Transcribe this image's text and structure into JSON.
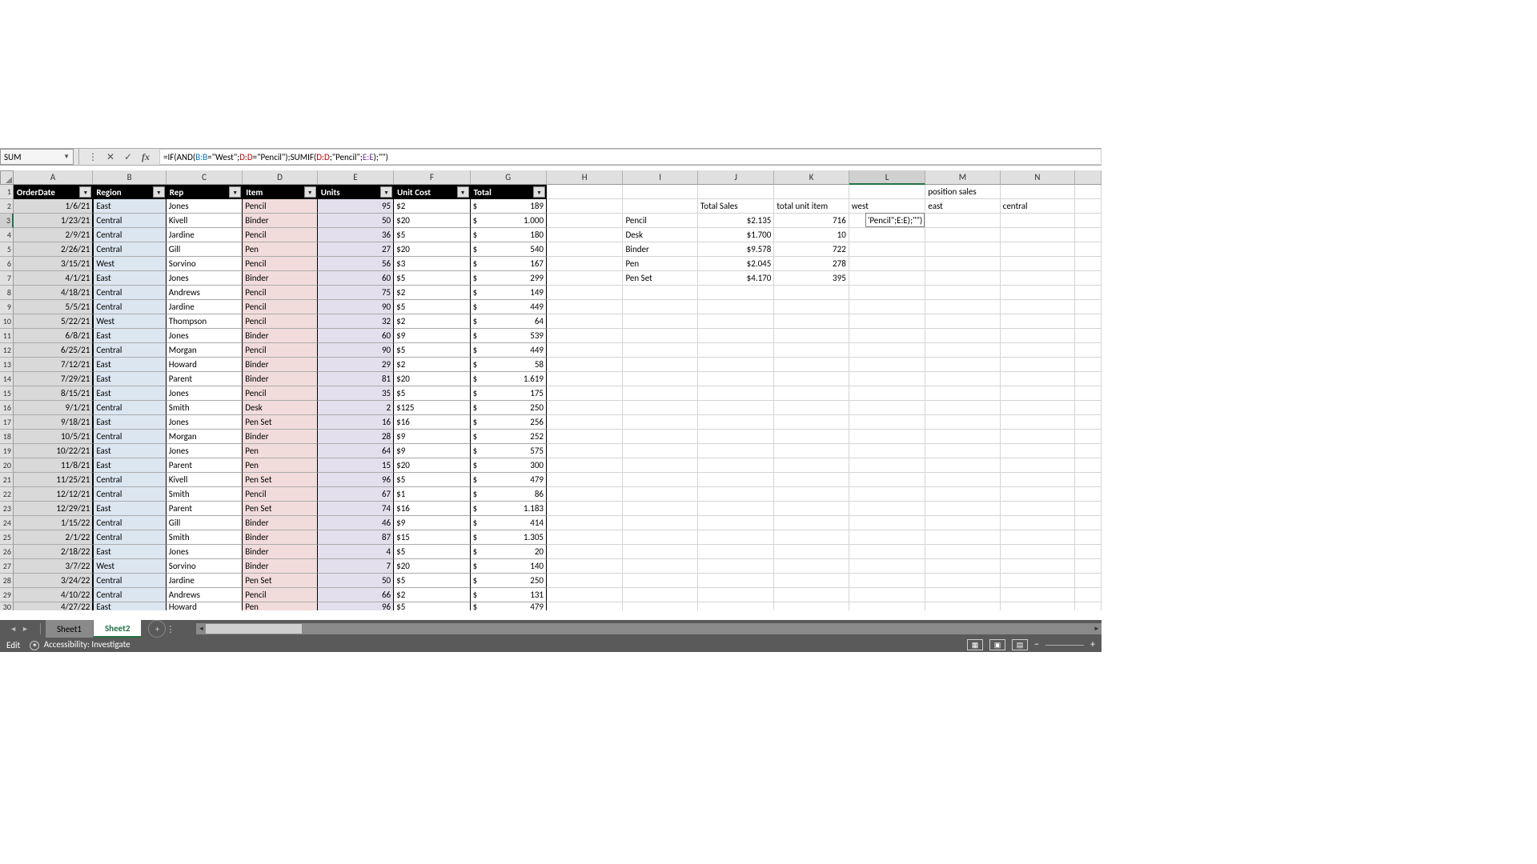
{
  "nameBox": "SUM",
  "formula": {
    "prefix": "=IF(AND(",
    "p1": "B:B",
    "mid1": "=\"West\";",
    "p2": "D:D",
    "mid2": "=\"Pencil\");SUMIF(",
    "p3": "D:D",
    "mid3": ";\"Pencil\";",
    "p4": "E:E",
    "suffix": ");\"\")"
  },
  "columns": [
    "A",
    "B",
    "C",
    "D",
    "E",
    "F",
    "G",
    "H",
    "I",
    "J",
    "K",
    "L",
    "M",
    "N"
  ],
  "activeCol": "L",
  "activeRow": 3,
  "headers": {
    "A": "OrderDate",
    "B": "Region",
    "C": "Rep",
    "D": "Item",
    "E": "Units",
    "F": "Unit Cost",
    "G": "Total"
  },
  "dataRows": [
    {
      "n": 2,
      "A": "1/6/21",
      "B": "East",
      "C": "Jones",
      "D": "Pencil",
      "E": "95",
      "F": "$2",
      "G": "189"
    },
    {
      "n": 3,
      "A": "1/23/21",
      "B": "Central",
      "C": "Kivell",
      "D": "Binder",
      "E": "50",
      "F": "$20",
      "G": "1.000"
    },
    {
      "n": 4,
      "A": "2/9/21",
      "B": "Central",
      "C": "Jardine",
      "D": "Pencil",
      "E": "36",
      "F": "$5",
      "G": "180"
    },
    {
      "n": 5,
      "A": "2/26/21",
      "B": "Central",
      "C": "Gill",
      "D": "Pen",
      "E": "27",
      "F": "$20",
      "G": "540"
    },
    {
      "n": 6,
      "A": "3/15/21",
      "B": "West",
      "C": "Sorvino",
      "D": "Pencil",
      "E": "56",
      "F": "$3",
      "G": "167"
    },
    {
      "n": 7,
      "A": "4/1/21",
      "B": "East",
      "C": "Jones",
      "D": "Binder",
      "E": "60",
      "F": "$5",
      "G": "299"
    },
    {
      "n": 8,
      "A": "4/18/21",
      "B": "Central",
      "C": "Andrews",
      "D": "Pencil",
      "E": "75",
      "F": "$2",
      "G": "149"
    },
    {
      "n": 9,
      "A": "5/5/21",
      "B": "Central",
      "C": "Jardine",
      "D": "Pencil",
      "E": "90",
      "F": "$5",
      "G": "449"
    },
    {
      "n": 10,
      "A": "5/22/21",
      "B": "West",
      "C": "Thompson",
      "D": "Pencil",
      "E": "32",
      "F": "$2",
      "G": "64"
    },
    {
      "n": 11,
      "A": "6/8/21",
      "B": "East",
      "C": "Jones",
      "D": "Binder",
      "E": "60",
      "F": "$9",
      "G": "539"
    },
    {
      "n": 12,
      "A": "6/25/21",
      "B": "Central",
      "C": "Morgan",
      "D": "Pencil",
      "E": "90",
      "F": "$5",
      "G": "449"
    },
    {
      "n": 13,
      "A": "7/12/21",
      "B": "East",
      "C": "Howard",
      "D": "Binder",
      "E": "29",
      "F": "$2",
      "G": "58"
    },
    {
      "n": 14,
      "A": "7/29/21",
      "B": "East",
      "C": "Parent",
      "D": "Binder",
      "E": "81",
      "F": "$20",
      "G": "1.619"
    },
    {
      "n": 15,
      "A": "8/15/21",
      "B": "East",
      "C": "Jones",
      "D": "Pencil",
      "E": "35",
      "F": "$5",
      "G": "175"
    },
    {
      "n": 16,
      "A": "9/1/21",
      "B": "Central",
      "C": "Smith",
      "D": "Desk",
      "E": "2",
      "F": "$125",
      "G": "250"
    },
    {
      "n": 17,
      "A": "9/18/21",
      "B": "East",
      "C": "Jones",
      "D": "Pen Set",
      "E": "16",
      "F": "$16",
      "G": "256"
    },
    {
      "n": 18,
      "A": "10/5/21",
      "B": "Central",
      "C": "Morgan",
      "D": "Binder",
      "E": "28",
      "F": "$9",
      "G": "252"
    },
    {
      "n": 19,
      "A": "10/22/21",
      "B": "East",
      "C": "Jones",
      "D": "Pen",
      "E": "64",
      "F": "$9",
      "G": "575"
    },
    {
      "n": 20,
      "A": "11/8/21",
      "B": "East",
      "C": "Parent",
      "D": "Pen",
      "E": "15",
      "F": "$20",
      "G": "300"
    },
    {
      "n": 21,
      "A": "11/25/21",
      "B": "Central",
      "C": "Kivell",
      "D": "Pen Set",
      "E": "96",
      "F": "$5",
      "G": "479"
    },
    {
      "n": 22,
      "A": "12/12/21",
      "B": "Central",
      "C": "Smith",
      "D": "Pencil",
      "E": "67",
      "F": "$1",
      "G": "86"
    },
    {
      "n": 23,
      "A": "12/29/21",
      "B": "East",
      "C": "Parent",
      "D": "Pen Set",
      "E": "74",
      "F": "$16",
      "G": "1.183"
    },
    {
      "n": 24,
      "A": "1/15/22",
      "B": "Central",
      "C": "Gill",
      "D": "Binder",
      "E": "46",
      "F": "$9",
      "G": "414"
    },
    {
      "n": 25,
      "A": "2/1/22",
      "B": "Central",
      "C": "Smith",
      "D": "Binder",
      "E": "87",
      "F": "$15",
      "G": "1.305"
    },
    {
      "n": 26,
      "A": "2/18/22",
      "B": "East",
      "C": "Jones",
      "D": "Binder",
      "E": "4",
      "F": "$5",
      "G": "20"
    },
    {
      "n": 27,
      "A": "3/7/22",
      "B": "West",
      "C": "Sorvino",
      "D": "Binder",
      "E": "7",
      "F": "$20",
      "G": "140"
    },
    {
      "n": 28,
      "A": "3/24/22",
      "B": "Central",
      "C": "Jardine",
      "D": "Pen Set",
      "E": "50",
      "F": "$5",
      "G": "250"
    },
    {
      "n": 29,
      "A": "4/10/22",
      "B": "Central",
      "C": "Andrews",
      "D": "Pencil",
      "E": "66",
      "F": "$2",
      "G": "131"
    },
    {
      "n": 30,
      "A": "4/27/22",
      "B": "East",
      "C": "Howard",
      "D": "Pen",
      "E": "96",
      "F": "$5",
      "G": "479"
    }
  ],
  "summary": {
    "row1": {
      "M": "position sales"
    },
    "row2": {
      "J": "Total Sales",
      "K": "total unit item",
      "L": "west",
      "M": "east",
      "N": "central"
    },
    "items": [
      {
        "I": "Pencil",
        "J": "$2.135",
        "K": "716",
        "L": "'Pencil\";E:E);\"\")"
      },
      {
        "I": "Desk",
        "J": "$1.700",
        "K": "10"
      },
      {
        "I": "Binder",
        "J": "$9.578",
        "K": "722"
      },
      {
        "I": "Pen",
        "J": "$2.045",
        "K": "278"
      },
      {
        "I": "Pen Set",
        "J": "$4.170",
        "K": "395"
      }
    ]
  },
  "tabs": {
    "sheet1": "Sheet1",
    "sheet2": "Sheet2"
  },
  "status": {
    "mode": "Edit",
    "acc": "Accessibility: Investigate"
  }
}
